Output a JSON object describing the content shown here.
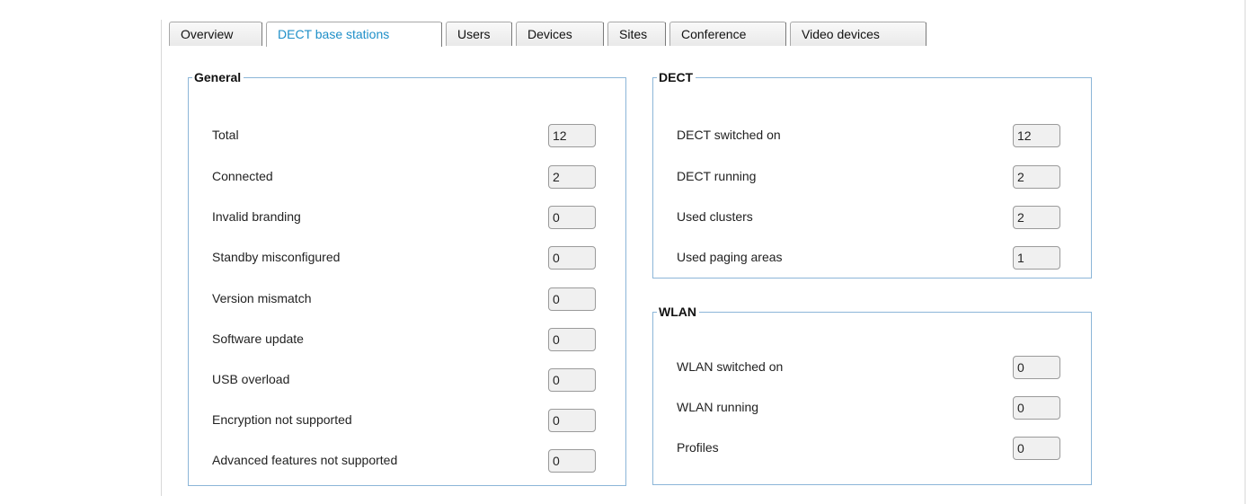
{
  "tabs": [
    {
      "label": "Overview",
      "active": false
    },
    {
      "label": "DECT base stations",
      "active": true
    },
    {
      "label": "Users",
      "active": false
    },
    {
      "label": "Devices",
      "active": false
    },
    {
      "label": "Sites",
      "active": false
    },
    {
      "label": "Conference",
      "active": false
    },
    {
      "label": "Video devices",
      "active": false
    }
  ],
  "general": {
    "title": "General",
    "rows": [
      {
        "label": "Total",
        "value": "12"
      },
      {
        "label": "Connected",
        "value": "2"
      },
      {
        "label": "Invalid branding",
        "value": "0"
      },
      {
        "label": "Standby misconfigured",
        "value": "0"
      },
      {
        "label": "Version mismatch",
        "value": "0"
      },
      {
        "label": "Software update",
        "value": "0"
      },
      {
        "label": "USB overload",
        "value": "0"
      },
      {
        "label": "Encryption not supported",
        "value": "0"
      },
      {
        "label": "Advanced features not supported",
        "value": "0"
      }
    ]
  },
  "dect": {
    "title": "DECT",
    "rows": [
      {
        "label": "DECT switched on",
        "value": "12"
      },
      {
        "label": "DECT running",
        "value": "2"
      },
      {
        "label": "Used clusters",
        "value": "2"
      },
      {
        "label": "Used paging areas",
        "value": "1"
      }
    ]
  },
  "wlan": {
    "title": "WLAN",
    "rows": [
      {
        "label": "WLAN switched on",
        "value": "0"
      },
      {
        "label": "WLAN running",
        "value": "0"
      },
      {
        "label": "Profiles",
        "value": "0"
      }
    ]
  },
  "colors": {
    "active_tab_text": "#1e8fc8",
    "group_border": "#8cb6d8",
    "value_bg": "#f0f0f0"
  }
}
